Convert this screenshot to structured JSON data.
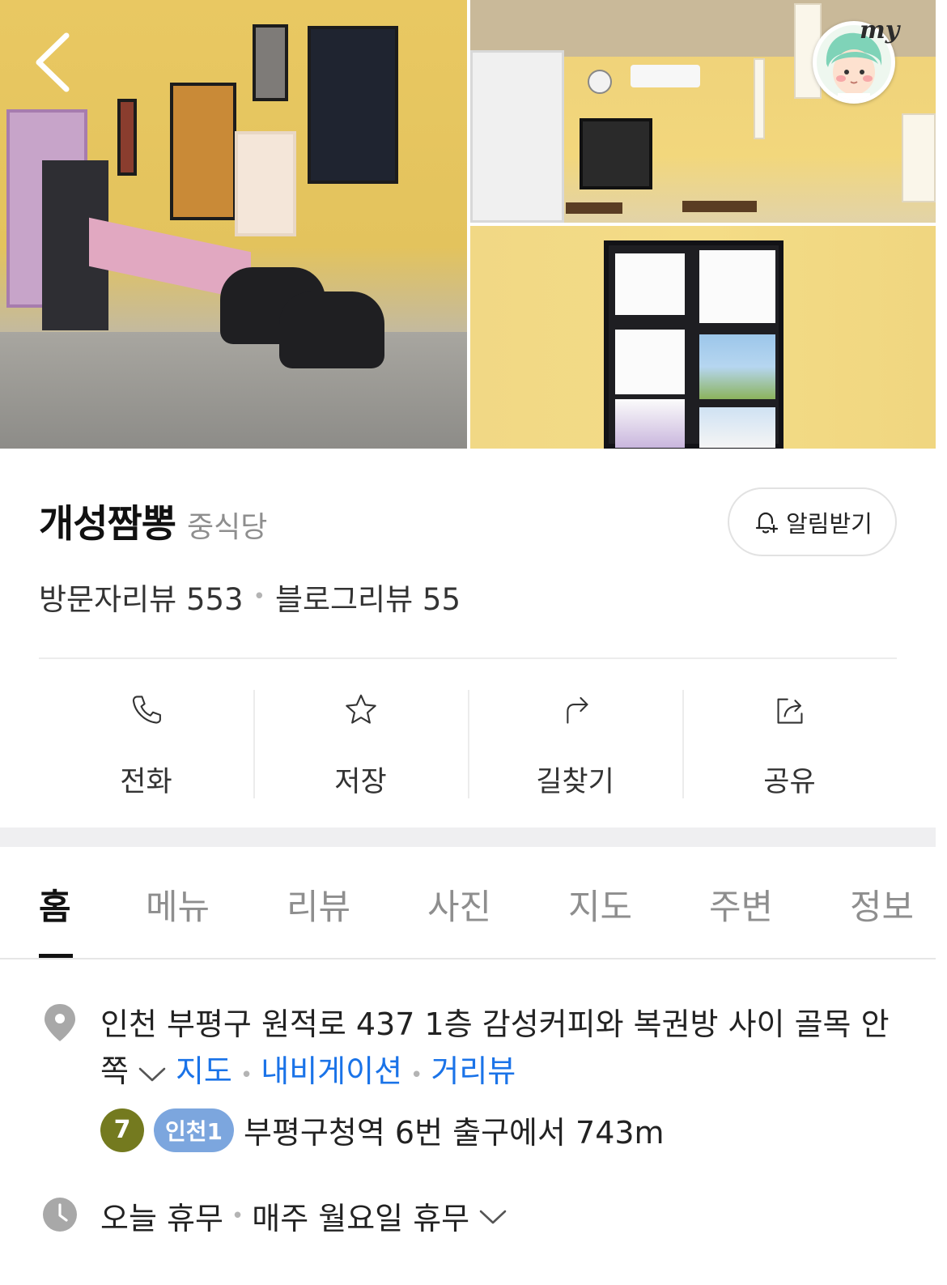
{
  "place": {
    "name": "개성짬뽕",
    "category": "중식당",
    "visitor_reviews": "방문자리뷰 553",
    "blog_reviews": "블로그리뷰 55",
    "alert_label": "알림받기"
  },
  "header": {
    "my_label": "my"
  },
  "actions": [
    {
      "label": "전화",
      "icon": "phone-icon"
    },
    {
      "label": "저장",
      "icon": "star-icon"
    },
    {
      "label": "길찾기",
      "icon": "directions-icon"
    },
    {
      "label": "공유",
      "icon": "share-icon"
    }
  ],
  "tabs": [
    {
      "label": "홈",
      "active": true
    },
    {
      "label": "메뉴",
      "active": false
    },
    {
      "label": "리뷰",
      "active": false
    },
    {
      "label": "사진",
      "active": false
    },
    {
      "label": "지도",
      "active": false
    },
    {
      "label": "주변",
      "active": false
    },
    {
      "label": "정보",
      "active": false
    }
  ],
  "info": {
    "address": "인천 부평구 원적로 437 1층 감성커피와 복권방 사이 골목 안쪽",
    "links": {
      "map": "지도",
      "navigation": "내비게이션",
      "street_view": "거리뷰"
    },
    "subway": {
      "line7": "7",
      "incheon1": "인천1",
      "text": "부평구청역 6번 출구에서 743m"
    },
    "hours": {
      "today": "오늘 휴무",
      "regular": "매주 월요일 휴무"
    }
  },
  "colors": {
    "accent_link": "#1a73e8",
    "line7": "#747a1f",
    "incheon1": "#7ca6de",
    "active_tab": "#111111",
    "inactive_tab": "#8e8e8e"
  }
}
